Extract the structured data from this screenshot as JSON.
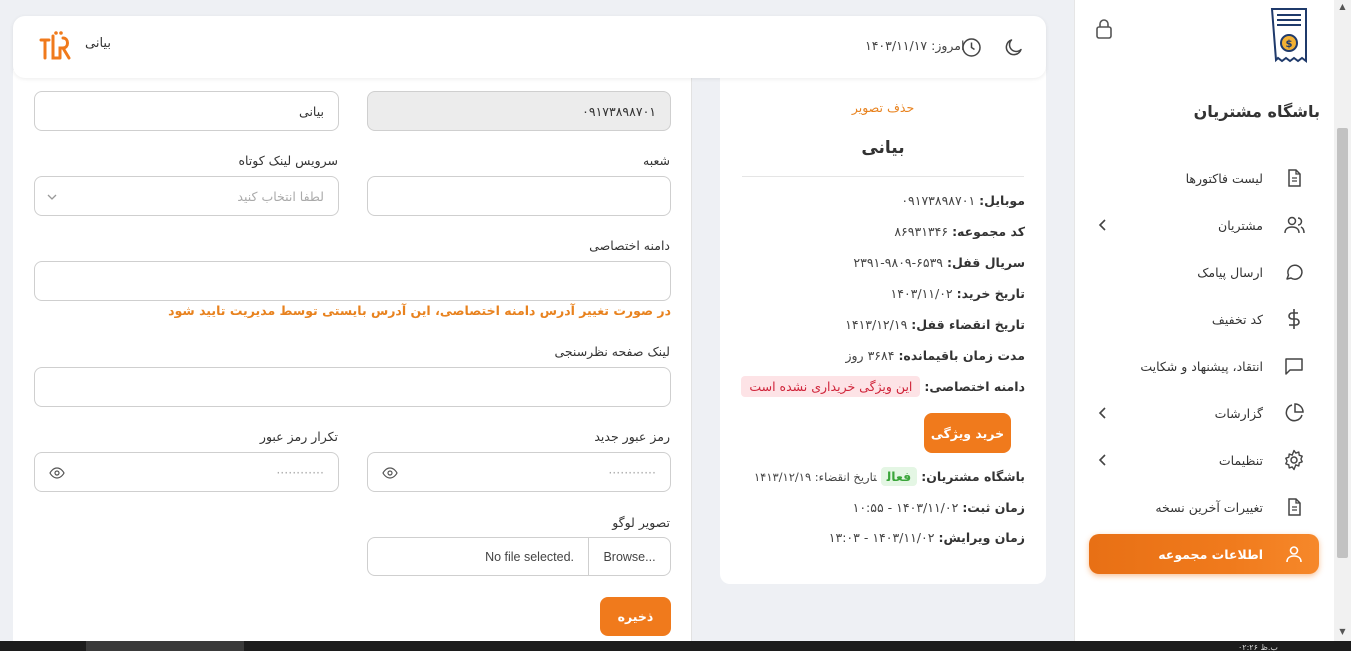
{
  "header": {
    "today_label": "امروز:",
    "today_date": "۱۴۰۳/۱۱/۱۷",
    "brand_name": "بیانی"
  },
  "sidebar": {
    "club_title": "باشگاه مشتریان",
    "items": [
      {
        "label": "لیست فاکتورها",
        "icon": "document-icon"
      },
      {
        "label": "مشتریان",
        "icon": "users-icon"
      },
      {
        "label": "ارسال پیامک",
        "icon": "message-circle-icon"
      },
      {
        "label": "کد تخفیف",
        "icon": "dollar-icon"
      },
      {
        "label": "انتقاد، پیشنهاد و شکایت",
        "icon": "message-square-icon"
      },
      {
        "label": "گزارشات",
        "icon": "pie-chart-icon"
      },
      {
        "label": "تنظیمات",
        "icon": "gear-icon"
      },
      {
        "label": "تغییرات آخرین نسخه",
        "icon": "document-icon"
      },
      {
        "label": "اطلاعات مجموعه",
        "icon": "user-icon"
      }
    ],
    "active_color": "#f07a1c"
  },
  "info_card": {
    "delete_image": "حذف تصویر",
    "name": "بیانی",
    "rows": {
      "mobile_k": "موبایل:",
      "mobile_v": "۰۹۱۷۳۸۹۸۷۰۱",
      "code_k": "کد مجموعه:",
      "code_v": "۸۶۹۳۱۳۴۶",
      "serial_k": "سریال قفل:",
      "serial_v": "۶۵۳۹-۹۸۰۹-۲۳۹۱",
      "purchase_k": "تاریخ خرید:",
      "purchase_v": "۱۴۰۳/۱۱/۰۲",
      "expire_k": "تاریخ انقضاء قفل:",
      "expire_v": "۱۴۱۳/۱۲/۱۹",
      "remain_k": "مدت زمان باقیمانده:",
      "remain_v": "۳۶۸۴ روز",
      "domain_k": "دامنه اختصاصی:",
      "domain_v": "این ویژگی خریداری نشده است",
      "club_k": "باشگاه مشتریان:",
      "club_status": "فعال",
      "club_expire": "تاریخ انقضاء: ۱۴۱۳/۱۲/۱۹",
      "reg_k": "زمان ثبت:",
      "reg_v": "۱۴۰۳/۱۱/۰۲ - ۱۰:۵۵",
      "edit_k": "زمان ویرایش:",
      "edit_v": "۱۴۰۳/۱۱/۰۲ - ۱۳:۰۳"
    },
    "buy_button": "خرید ویژگی"
  },
  "form": {
    "mobile_value": "۰۹۱۷۳۸۹۸۷۰۱",
    "name_value": "بیانی",
    "branch_label": "شعبه",
    "branch_value": "",
    "shortlink_label": "سرویس لینک کوتاه",
    "shortlink_placeholder": "لطفا انتخاب کنید",
    "domain_label": "دامنه اختصاصی",
    "domain_value": "",
    "domain_warning": "در صورت تغییر آدرس دامنه اختصاصی، این آدرس بایستی توسط مدیریت تایید شود",
    "survey_label": "لینک صفحه نظرسنجی",
    "survey_value": "",
    "new_password_label": "رمز عبور جدید",
    "new_password_placeholder": "············",
    "repeat_password_label": "تکرار رمز عبور",
    "repeat_password_placeholder": "············",
    "logo_label": "تصویر لوگو",
    "browse_label": "Browse...",
    "file_status": "No file selected.",
    "save_button": "ذخیره"
  },
  "taskbar": {
    "time": "۰۲:۲۶ ب.ظ"
  }
}
